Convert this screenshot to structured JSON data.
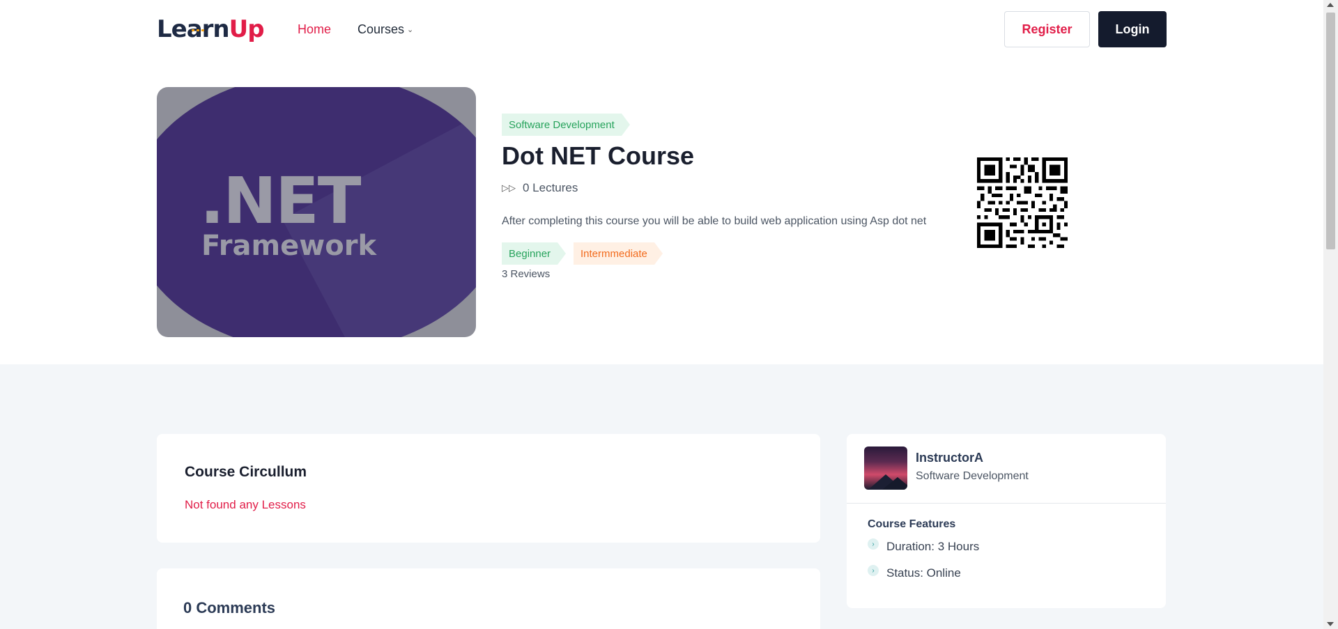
{
  "brand": {
    "logo_part1": "Learn",
    "logo_part2": "Up",
    "accent": "#e11d48",
    "dark": "#141b2d"
  },
  "nav": {
    "home": "Home",
    "courses": "Courses"
  },
  "auth": {
    "register": "Register",
    "login": "Login"
  },
  "course": {
    "category": "Software Development",
    "title": "Dot NET Course",
    "lectures": "0 Lectures",
    "description": "After completing this course you will be able to build web application using Asp dot net",
    "levels": [
      "Beginner",
      "Intermmediate"
    ],
    "reviews": "3 Reviews",
    "image_text": {
      "line1": ".NET",
      "line2": "Framework"
    }
  },
  "curriculum": {
    "title": "Course Circullum",
    "empty": "Not found any Lessons"
  },
  "comments": {
    "title": "0 Comments"
  },
  "instructor": {
    "name": "InstructorA",
    "category": "Software Development"
  },
  "features": {
    "title": "Course Features",
    "items": [
      "Duration: 3 Hours",
      "Status: Online"
    ]
  },
  "icons": {
    "play": "play-forward-icon",
    "chevron": "chevron-down-icon",
    "bullet": "chevron-right-icon",
    "qr": "qr-code-icon"
  }
}
